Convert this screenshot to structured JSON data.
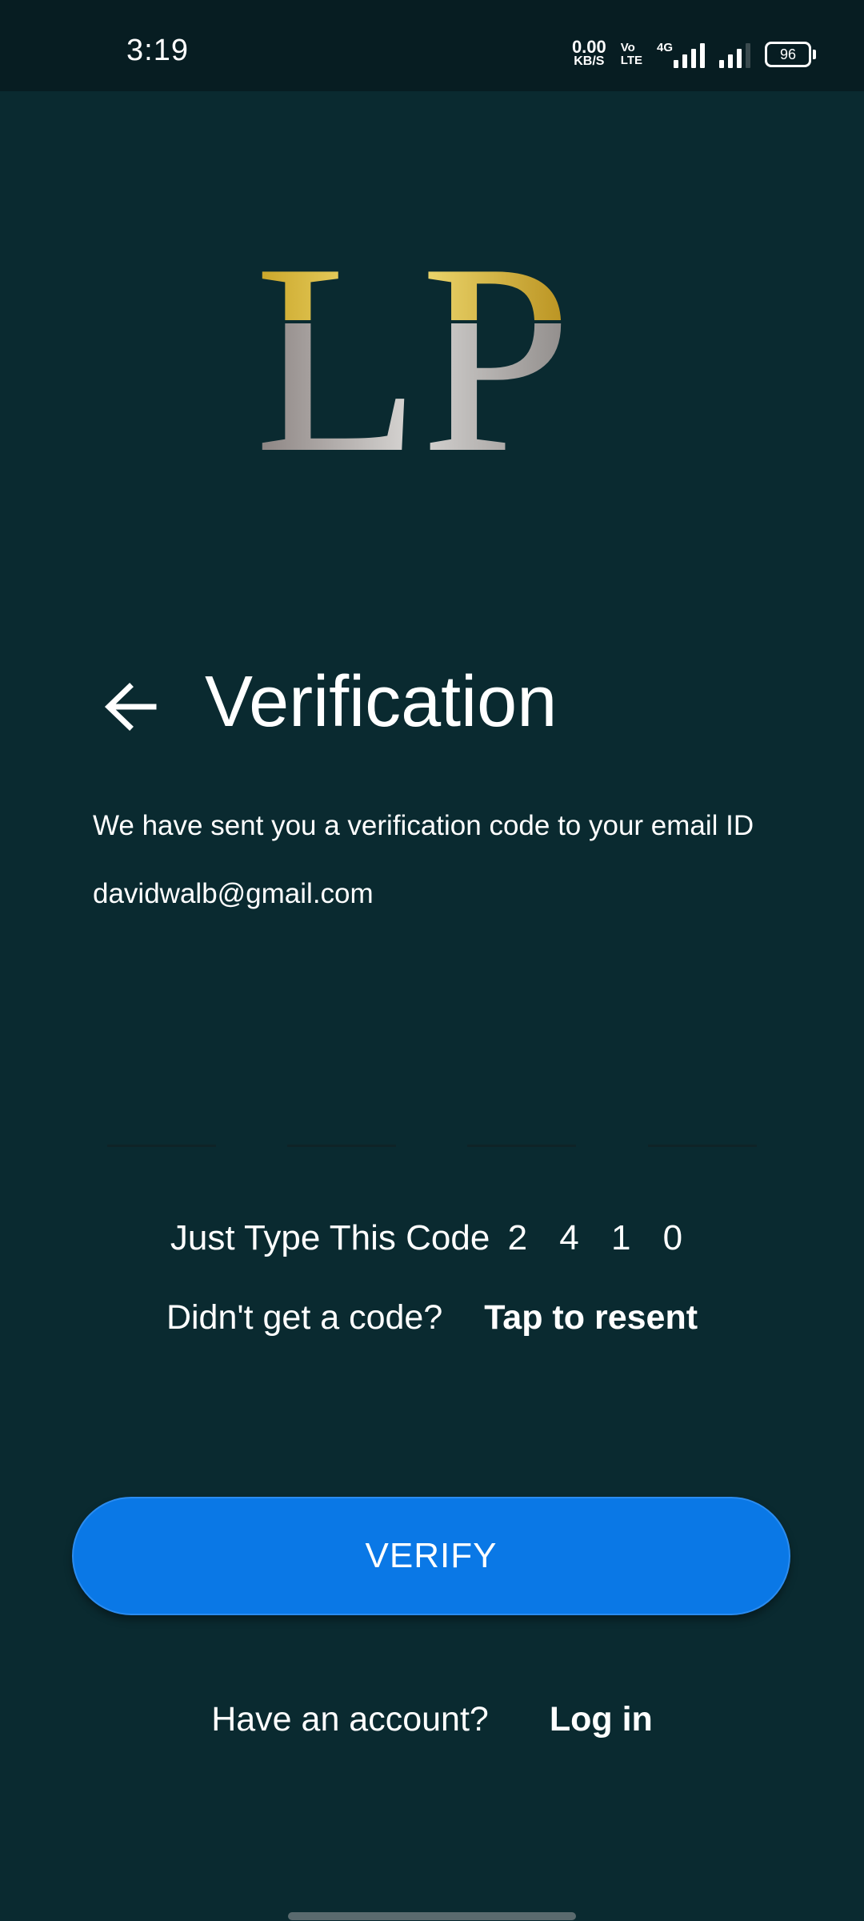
{
  "status_bar": {
    "time": "3:19",
    "net_speed_value": "0.00",
    "net_speed_unit": "KB/S",
    "volte_top": "Vo",
    "volte_bottom": "LTE",
    "network_type": "4G",
    "battery_level": "96"
  },
  "logo": {
    "text": "LP"
  },
  "header": {
    "back_icon": "arrow-left-icon",
    "title": "Verification"
  },
  "description": "We have sent you a verification code to your email ID",
  "email": "davidwalb@gmail.com",
  "otp": {
    "fields": [
      "",
      "",
      "",
      ""
    ]
  },
  "code_hint": {
    "label": "Just Type This Code",
    "digits": "2 4 1 0"
  },
  "resend": {
    "question": "Didn't get a code?",
    "link": "Tap to resent"
  },
  "verify_button": {
    "label": "VERIFY"
  },
  "login": {
    "question": "Have an account?",
    "link": "Log in"
  },
  "colors": {
    "background": "#0a2a30",
    "status_bar": "#071d22",
    "primary_button": "#0a78e6",
    "logo_gold": "#d9b23a",
    "logo_silver": "#a9a4a2"
  }
}
